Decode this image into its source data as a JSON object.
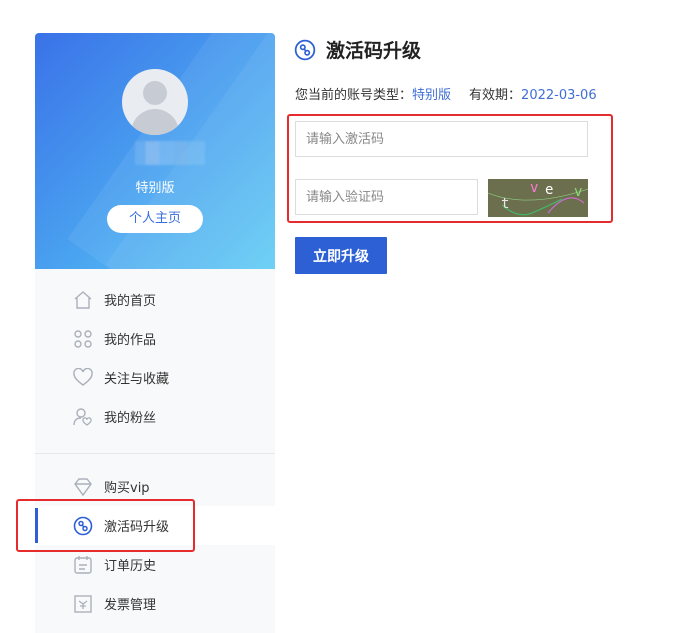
{
  "colors": {
    "accent": "#2d5fd5",
    "highlight": "#e52b2b",
    "link": "#3f6fd6"
  },
  "profile": {
    "level": "特别版",
    "home_button": "个人主页"
  },
  "menu": {
    "items": [
      {
        "label": "我的首页",
        "icon": "home-icon"
      },
      {
        "label": "我的作品",
        "icon": "grid-icon"
      },
      {
        "label": "关注与收藏",
        "icon": "heart-icon"
      },
      {
        "label": "我的粉丝",
        "icon": "user-heart-icon"
      }
    ],
    "items2": [
      {
        "label": "购买vip",
        "icon": "diamond-icon"
      },
      {
        "label": "激活码升级",
        "icon": "activation-icon",
        "active": true
      },
      {
        "label": "订单历史",
        "icon": "calendar-list-icon"
      },
      {
        "label": "发票管理",
        "icon": "invoice-icon"
      }
    ]
  },
  "main": {
    "title": "激活码升级",
    "account_type_label": "您当前的账号类型：",
    "account_type_value": "特别版",
    "validity_label": "有效期：",
    "validity_value": "2022-03-06",
    "code_placeholder": "请输入激活码",
    "verify_placeholder": "请输入验证码",
    "captcha_text": "tvev",
    "upgrade_button": "立即升级"
  }
}
